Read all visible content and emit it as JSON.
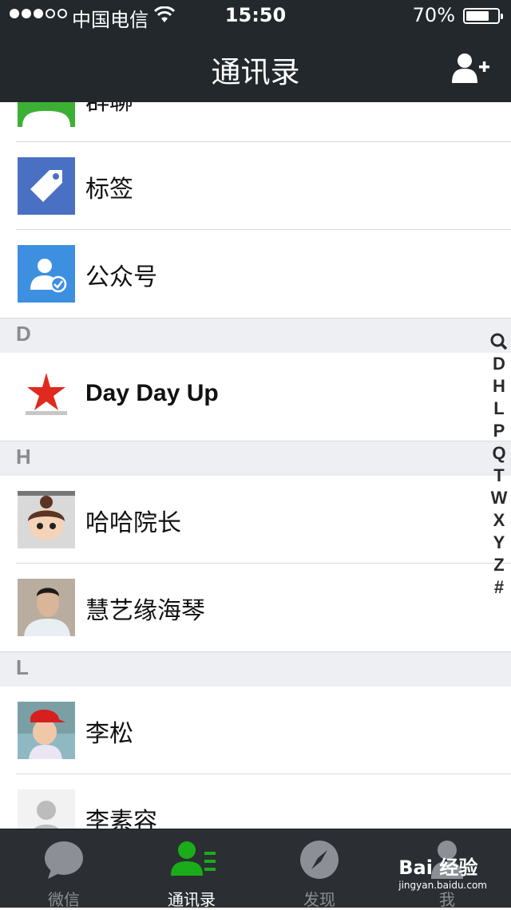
{
  "status_bar": {
    "carrier": "中国电信",
    "time": "15:50",
    "battery": "70%"
  },
  "nav": {
    "title": "通讯录",
    "add_icon": "add-contact-icon"
  },
  "contacts": {
    "functions": [
      {
        "label": "群聊",
        "icon": "group-chat-icon",
        "color": "#3cb034"
      },
      {
        "label": "标签",
        "icon": "tag-icon",
        "color": "#4a70c3"
      },
      {
        "label": "公众号",
        "icon": "official-account-icon",
        "color": "#3d8fe0"
      }
    ],
    "sections": [
      {
        "letter": "D",
        "items": [
          {
            "name": "Day Day Up"
          }
        ]
      },
      {
        "letter": "H",
        "items": [
          {
            "name": "哈哈院长"
          },
          {
            "name": "慧艺缘海琴"
          }
        ]
      },
      {
        "letter": "L",
        "items": [
          {
            "name": "李松"
          },
          {
            "name": "李素容"
          }
        ]
      }
    ]
  },
  "index_bar": [
    "D",
    "H",
    "L",
    "P",
    "Q",
    "T",
    "W",
    "X",
    "Y",
    "Z",
    "#"
  ],
  "tabs": [
    {
      "label": "微信",
      "icon": "chat-bubble-icon"
    },
    {
      "label": "通讯录",
      "icon": "contacts-icon",
      "active": true
    },
    {
      "label": "发现",
      "icon": "compass-icon"
    },
    {
      "label": "我",
      "icon": "me-icon"
    }
  ],
  "watermark": {
    "text": "Bai 经验",
    "url_text": "jingyan.baidu.com"
  },
  "colors": {
    "nav_bg": "#22282c",
    "active_tab": "#1aad19",
    "section_bg": "#eeeff3"
  }
}
